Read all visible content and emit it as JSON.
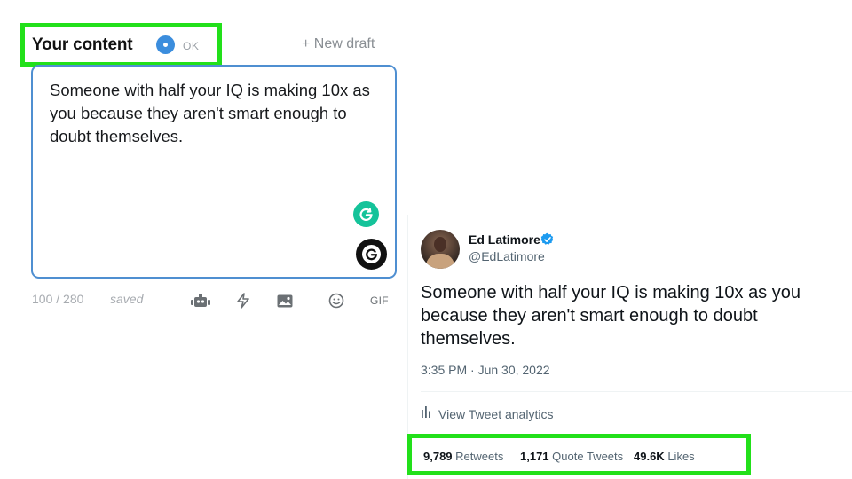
{
  "composer": {
    "section_title": "Your content",
    "status_text": "OK",
    "new_draft_label": "+ New draft",
    "draft_text": "Someone with half your IQ is making 10x as you because they aren't smart enough to doubt themselves.",
    "char_count": "100 / 280",
    "save_state": "saved",
    "toolbar": {
      "icons": [
        "robot-icon",
        "lightning-icon",
        "image-icon",
        "emoji-icon"
      ],
      "gif_label": "GIF"
    }
  },
  "tweet": {
    "author_name": "Ed Latimore",
    "author_handle": "@EdLatimore",
    "text": "Someone with half your IQ is making 10x as you because they aren't smart enough to doubt themselves.",
    "timestamp": "3:35 PM · Jun 30, 2022",
    "analytics_label": "View Tweet analytics",
    "stats": {
      "retweets_count": "9,789",
      "retweets_label": "Retweets",
      "quotes_count": "1,171",
      "quotes_label": "Quote Tweets",
      "likes_count": "49.6K",
      "likes_label": "Likes"
    }
  },
  "colors": {
    "highlight": "#22e01a",
    "editor_border": "#4f8fd1",
    "status_dot": "#3b8ddd",
    "grammarly_green": "#15c39a",
    "twitter_blue": "#1d9bf0"
  }
}
